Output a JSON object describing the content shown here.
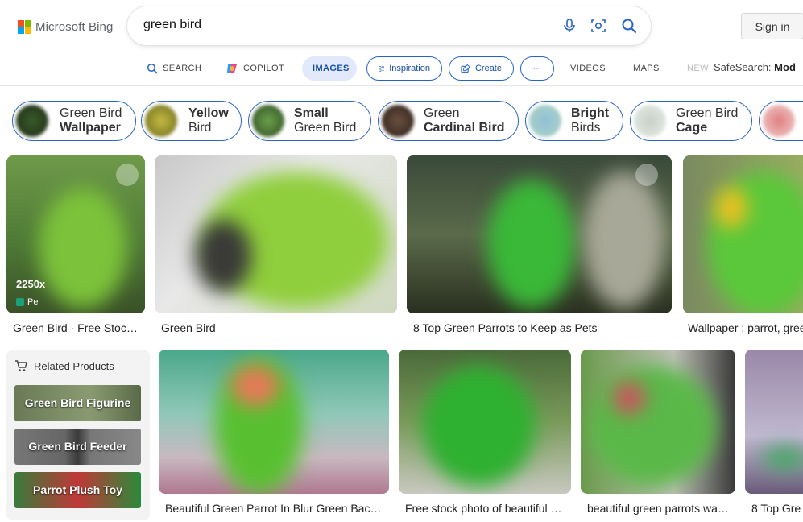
{
  "header": {
    "logo_text": "Microsoft Bing",
    "search_value": "green bird",
    "sign_in_label": "Sign in",
    "safesearch_label": "SafeSearch:",
    "safesearch_value": "Mod"
  },
  "nav": {
    "search": "SEARCH",
    "copilot": "COPILOT",
    "images": "IMAGES",
    "inspiration": "Inspiration",
    "create": "Create",
    "more": "···",
    "videos": "VIDEOS",
    "maps": "MAPS",
    "news": "NEW"
  },
  "chips": [
    {
      "line1": "Green Bird",
      "line2": "Wallpaper",
      "bold_line": 2
    },
    {
      "line1": "Yellow",
      "line2": "Bird",
      "bold_line": 1
    },
    {
      "line1": "Small",
      "line2": "Green Bird",
      "bold_line": 1
    },
    {
      "line1": "Green",
      "line2": "Cardinal Bird",
      "bold_line": 2
    },
    {
      "line1": "Bright",
      "line2": "Birds",
      "bold_line": 1
    },
    {
      "line1": "Green Bird",
      "line2": "Cage",
      "bold_line": 2
    }
  ],
  "results_row1": [
    {
      "caption": "Green Bird · Free Stoc…",
      "size_text": "2250x",
      "source": "Pe"
    },
    {
      "caption": "Green Bird"
    },
    {
      "caption": "8 Top Green Parrots to Keep as Pets"
    },
    {
      "caption": "Wallpaper : parrot, gree"
    }
  ],
  "related_products": {
    "title": "Related Products",
    "items": [
      "Green Bird Figurine",
      "Green Bird Feeder",
      "Parrot Plush Toy"
    ]
  },
  "results_row2": [
    {
      "caption": "Beautiful Green Parrot In Blur Green Bac…"
    },
    {
      "caption": "Free stock photo of beautiful …"
    },
    {
      "caption": "beautiful green parrots wa…"
    },
    {
      "caption": "8 Top Gre"
    }
  ],
  "colors": {
    "accent": "#2762c7",
    "active_tab_bg": "#e1e9fa"
  }
}
